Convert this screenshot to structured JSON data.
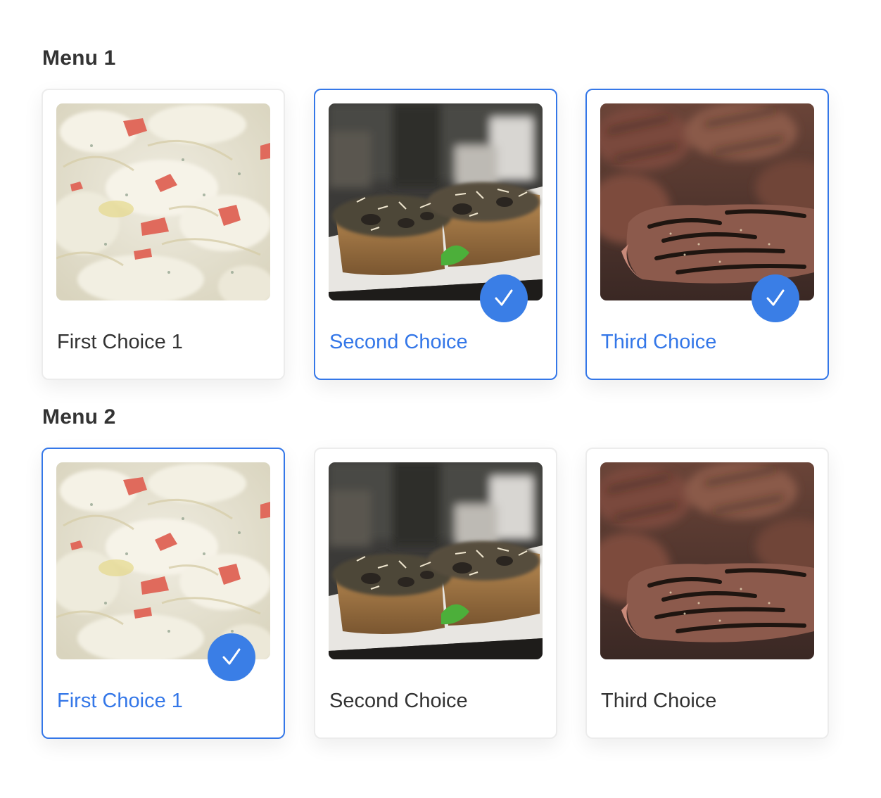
{
  "accent_color": "#3477e8",
  "check_icon": "checkmark-icon",
  "menus": [
    {
      "title": "Menu 1",
      "options": [
        {
          "label": "First Choice 1",
          "image": "ravioli-photo",
          "selected": false
        },
        {
          "label": "Second Choice",
          "image": "bruschetta-photo",
          "selected": true
        },
        {
          "label": "Third Choice",
          "image": "steak-photo",
          "selected": true
        }
      ]
    },
    {
      "title": "Menu 2",
      "options": [
        {
          "label": "First Choice 1",
          "image": "ravioli-photo",
          "selected": true
        },
        {
          "label": "Second Choice",
          "image": "bruschetta-photo",
          "selected": false
        },
        {
          "label": "Third Choice",
          "image": "steak-photo",
          "selected": false
        }
      ]
    }
  ]
}
